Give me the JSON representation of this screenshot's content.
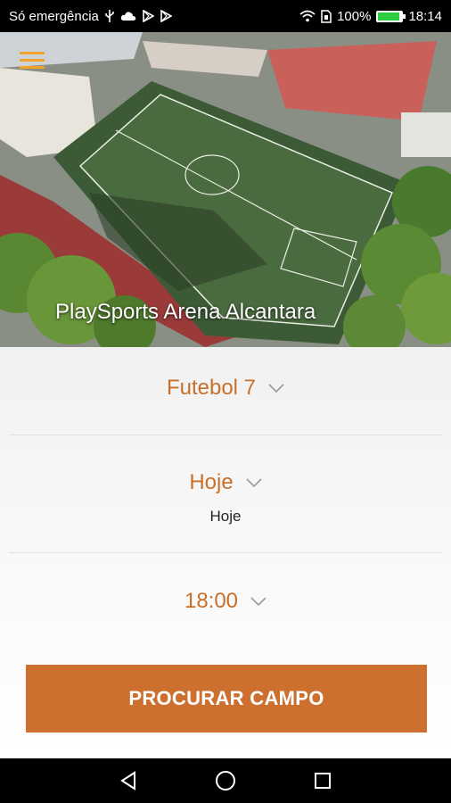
{
  "status_bar": {
    "carrier": "Só emergência",
    "battery_percent": "100%",
    "time": "18:14",
    "battery_color": "#2ecc40"
  },
  "hero": {
    "venue_name": "PlaySports Arena Alcantara",
    "menu_icon": "hamburger-menu-icon",
    "menu_color": "#f0a52a"
  },
  "filters": {
    "sport": {
      "selected": "Futebol 7"
    },
    "date": {
      "selected": "Hoje",
      "caption": "Hoje"
    },
    "time": {
      "selected": "18:00"
    }
  },
  "search_button": {
    "label": "PROCURAR CAMPO",
    "color": "#cd702f"
  },
  "accent_color": "#c8702a",
  "nav_bar": {
    "icons": [
      "back-icon",
      "home-icon",
      "recents-icon"
    ]
  }
}
